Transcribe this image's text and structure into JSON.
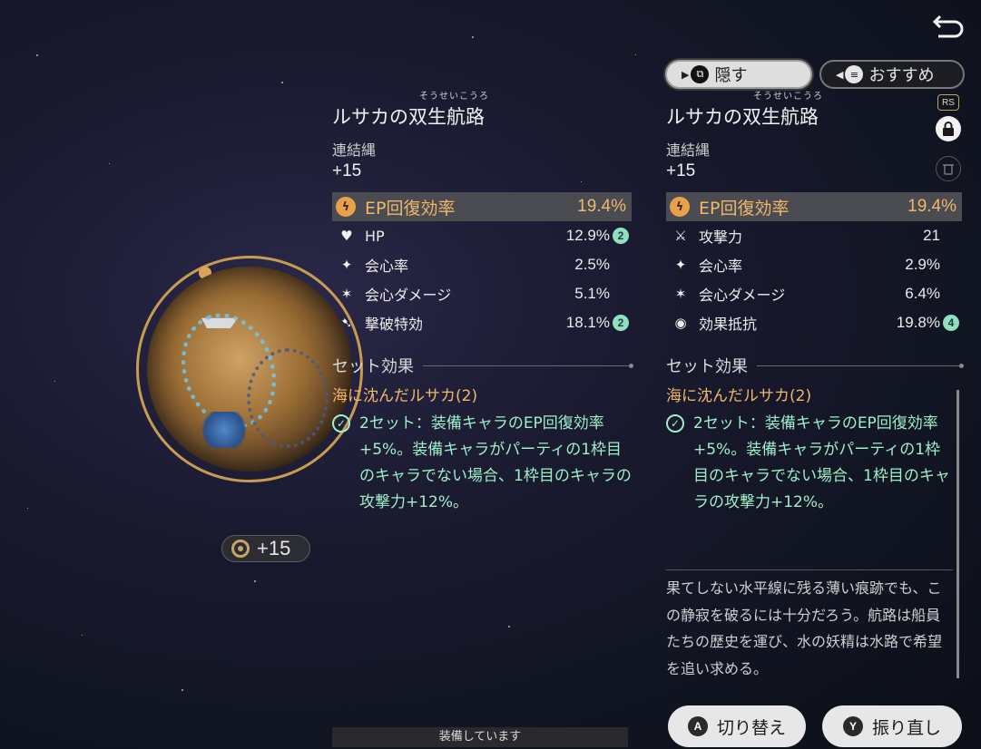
{
  "buttons": {
    "hide_label": "隠す",
    "recommend_label": "おすすめ",
    "switch_label": "切り替え",
    "switch_key": "A",
    "reroll_label": "振り直し",
    "reroll_key": "Y",
    "rs_tag": "RS"
  },
  "relic": {
    "level_badge": "+15"
  },
  "left": {
    "ruby": "そうせいこうろ",
    "title": "ルサカの双生航路",
    "slot": "連結縄",
    "level": "+15",
    "main_stat": {
      "name": "EP回復効率",
      "value": "19.4%"
    },
    "sub_stats": [
      {
        "name": "HP",
        "value": "12.9%",
        "rolls": "2",
        "icon": "heart-icon"
      },
      {
        "name": "会心率",
        "value": "2.5%",
        "rolls": "",
        "icon": "crit-rate-icon"
      },
      {
        "name": "会心ダメージ",
        "value": "5.1%",
        "rolls": "",
        "icon": "crit-dmg-icon"
      },
      {
        "name": "撃破特効",
        "value": "18.1%",
        "rolls": "2",
        "icon": "break-effect-icon"
      }
    ],
    "set_header": "セット効果",
    "set_name": "海に沈んだルサカ(2)",
    "set_effect": "2セット：装備キャラのEP回復効率+5%。装備キャラがパーティの1枠目のキャラでない場合、1枠目のキャラの攻撃力+12%。",
    "equipped": "装備しています"
  },
  "right": {
    "ruby": "そうせいこうろ",
    "title": "ルサカの双生航路",
    "slot": "連結縄",
    "level": "+15",
    "main_stat": {
      "name": "EP回復効率",
      "value": "19.4%"
    },
    "sub_stats": [
      {
        "name": "攻撃力",
        "value": "21",
        "rolls": "",
        "icon": "sword-icon"
      },
      {
        "name": "会心率",
        "value": "2.9%",
        "rolls": "",
        "icon": "crit-rate-icon"
      },
      {
        "name": "会心ダメージ",
        "value": "6.4%",
        "rolls": "",
        "icon": "crit-dmg-icon"
      },
      {
        "name": "効果抵抗",
        "value": "19.8%",
        "rolls": "4",
        "icon": "effect-res-icon"
      }
    ],
    "set_header": "セット効果",
    "set_name": "海に沈んだルサカ(2)",
    "set_effect": "2セット：装備キャラのEP回復効率+5%。装備キャラがパーティの1枠目のキャラでない場合、1枠目のキャラの攻撃力+12%。",
    "description": "果てしない水平線に残る薄い痕跡でも、この静寂を破るには十分だろう。航路は船員たちの歴史を運び、水の妖精は水路で希望を追い求める。"
  },
  "colors": {
    "accent_orange": "#f0b86a",
    "set_effect_green": "#9ef0c8",
    "roll_badge": "#8ee0c0"
  }
}
